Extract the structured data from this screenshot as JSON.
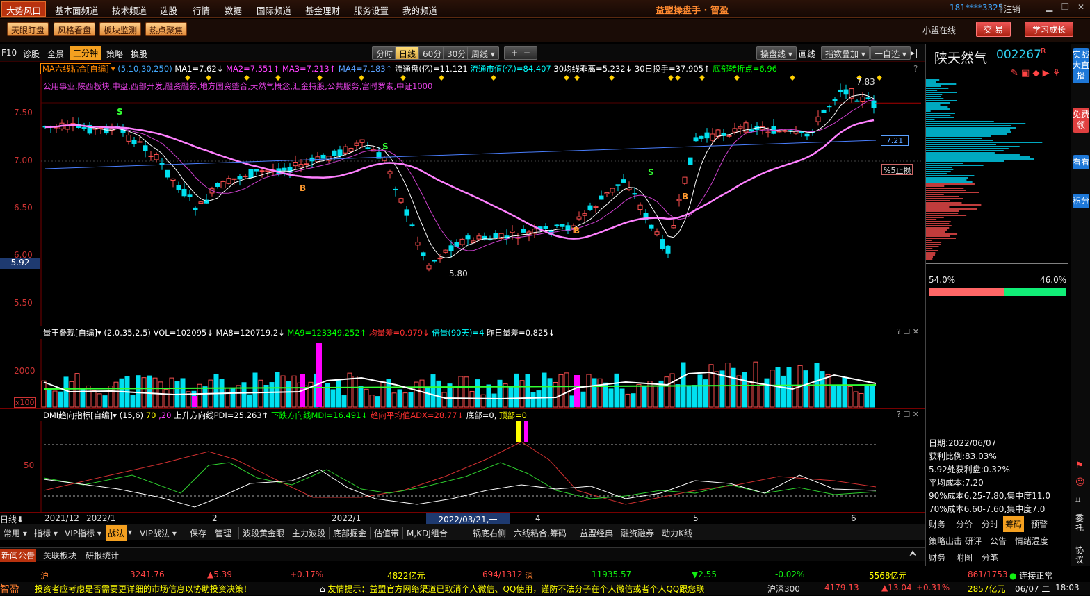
{
  "topmenu": {
    "items": [
      "大势风口",
      "基本面频道",
      "技术频道",
      "选股",
      "行情",
      "数据",
      "国际频道",
      "基金理财",
      "服务设置",
      "我的频道"
    ],
    "title": "益盟操盘手 · 智盈",
    "user": "181****3325",
    "logout": "注销"
  },
  "toolbar": {
    "buttons": [
      "天眼盯盘",
      "风格看盘",
      "板块监测",
      "热点聚焦"
    ],
    "online": "小盟在线",
    "trade": "交 易",
    "learn": "学习成长"
  },
  "chartbar": {
    "left": [
      "F10",
      "诊股",
      "全景",
      "三分钟",
      "策略",
      "换股"
    ],
    "periods": [
      "分时",
      "日线",
      "60分",
      "30分",
      "周线"
    ],
    "period_selected": "日线",
    "zoom_in": "+",
    "zoom_out": "−",
    "right": [
      "操盘线",
      "画线",
      "指数叠加",
      "一自选"
    ]
  },
  "stock": {
    "name": "陕天然气",
    "code": "002267",
    "flag": "R"
  },
  "ma_header": {
    "name": "MA六线粘合[自编]",
    "params": "(5,10,30,250)",
    "items": [
      {
        "t": "MA1=7.62↓",
        "c": "#fff"
      },
      {
        "t": "MA2=7.551↑",
        "c": "#ff40ff"
      },
      {
        "t": "MA3=7.213↑",
        "c": "#ff40ff"
      },
      {
        "t": "MA4=7.183↑",
        "c": "#5aa0ff"
      },
      {
        "t": "流通盘(亿)=11.121",
        "c": "#fff"
      },
      {
        "t": "流通市值(亿)=84.407",
        "c": "#00ffff"
      },
      {
        "t": "30均线乖离=5.232↓",
        "c": "#fff"
      },
      {
        "t": "30日换手=37.905↑",
        "c": "#fff"
      },
      {
        "t": "底部转折点=6.96",
        "c": "#00ff00"
      }
    ]
  },
  "concepts": "公用事业,陕西板块,中盘,西部开发,融资融券,地方国资整合,天然气概念,汇金持股,公共服务,富时罗素,中证1000",
  "price_axis": [
    "7.50",
    "7.00",
    "6.50",
    "6.00",
    "5.50"
  ],
  "current_price_label": "5.92",
  "annotations": {
    "high": "7.83",
    "low": "5.80",
    "ma_value": "7.21",
    "stop": "%5止损"
  },
  "vol_header": {
    "name": "量王叠现[自编]",
    "params": "(2,0.35,2.5)",
    "items": [
      {
        "t": "VOL=102095↓",
        "c": "#fff"
      },
      {
        "t": "MA8=120719.2↓",
        "c": "#fff"
      },
      {
        "t": "MA9=123349.252↑",
        "c": "#00ff00"
      },
      {
        "t": "均量差=0.979↓",
        "c": "#ff3030"
      },
      {
        "t": "倍量(90天)=4",
        "c": "#00ffff"
      },
      {
        "t": "昨日量差=0.825↓",
        "c": "#fff"
      }
    ]
  },
  "vol_axis": [
    "2000",
    "x100"
  ],
  "dmi_header": {
    "name": "DMI趋向指标[自编]",
    "params": "(15,6)",
    "items": [
      {
        "t": "70",
        "c": "#ffff00"
      },
      {
        "t": ",20",
        "c": "#ff40ff"
      },
      {
        "t": "上升方向线PDI=25.263↑",
        "c": "#fff"
      },
      {
        "t": "下跌方向线MDI=16.491↓",
        "c": "#00ff00"
      },
      {
        "t": "趋向平均值ADX=28.77↓",
        "c": "#ff3030"
      },
      {
        "t": "底部=0,",
        "c": "#fff"
      },
      {
        "t": "顶部=0",
        "c": "#ffff00"
      }
    ]
  },
  "dmi_axis": [
    "50"
  ],
  "dates": {
    "mode": "日线",
    "labels": [
      "2021/12",
      "2022/1",
      "2",
      "2022/1",
      "4",
      "5",
      "6"
    ],
    "cursor": "2022/03/21,一"
  },
  "bottom_tabs": [
    "常用",
    "指标",
    "VIP指标",
    "战法",
    "VIP战法",
    "保存",
    "管理",
    "波段黄金眼",
    "主力波段",
    "底部掘金",
    "估值带",
    "M,KDJ组合",
    "锅底右侧",
    "六线粘合,筹码",
    "益盟经典",
    "融资融券",
    "动力K线"
  ],
  "bottom_selected": "战法",
  "news_tabs": [
    "新闻公告",
    "关联板块",
    "研报统计"
  ],
  "index_bar": {
    "sh_label": "沪",
    "sh_val": "3241.76",
    "sh_chg": "▲5.39",
    "sh_pct": "+0.17%",
    "sh_amt": "4822亿元",
    "sh_ud": "694/1312",
    "sz_label": "深",
    "sz_val": "11935.57",
    "sz_chg": "▼2.55",
    "sz_pct": "-0.02%",
    "sz_amt": "5568亿元",
    "sz_ud": "861/1753",
    "conn": "连接正常"
  },
  "ticker": {
    "logo": "智盈",
    "text1": "投资者应考虑是否需要更详细的市场信息以协助投资决策！",
    "text2": "友情提示：益盟官方网络渠道已取消个人微信、QQ使用，谨防不法分子在个人微信或者个人QQ跟您联",
    "hs300": "沪深300",
    "hs_val": "4179.13",
    "hs_chg": "▲13.04",
    "hs_pct": "+0.31%",
    "hs_amt": "2857亿元",
    "date": "06/07 二",
    "time": "18:03"
  },
  "chip": {
    "pct_left": "54.0%",
    "pct_right": "46.0%",
    "date": "日期:2022/06/07",
    "profit_ratio": "获利比例:83.03%",
    "profit_at": "5.92处获利盘:0.32%",
    "avg_cost": "平均成本:7.20",
    "c90": "90%成本6.25-7.80,集中度11.0",
    "c70": "70%成本6.60-7.60,集中度7.0",
    "tabs1": [
      "财务",
      "分价",
      "分时",
      "筹码",
      "预警"
    ],
    "tab_selected": "筹码",
    "tabs2": [
      "策略出击",
      "研评",
      "公告",
      "情绪温度"
    ],
    "tabs3": [
      "财务",
      "附图",
      "分笔"
    ]
  },
  "side_tabs": [
    "实战大直播",
    "免费领",
    "看看",
    "积分"
  ],
  "side_tools": [
    "委托",
    "协议"
  ]
}
